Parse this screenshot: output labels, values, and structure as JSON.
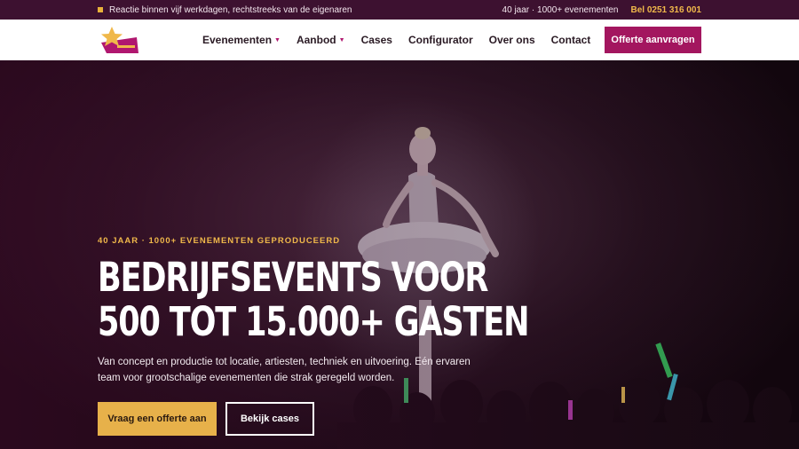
{
  "topbar": {
    "notice": "Reactie binnen vijf werkdagen, rechtstreeks van de eigenaren",
    "stats": "40 jaar · 1000+ evenementen",
    "phone": "Bel 0251 316 001"
  },
  "nav": {
    "items": [
      {
        "label": "Evenementen",
        "has_dropdown": true
      },
      {
        "label": "Aanbod",
        "has_dropdown": true
      },
      {
        "label": "Cases",
        "has_dropdown": false
      },
      {
        "label": "Configurator",
        "has_dropdown": false
      },
      {
        "label": "Over ons",
        "has_dropdown": false
      },
      {
        "label": "Contact",
        "has_dropdown": false
      }
    ],
    "cta": "Offerte aanvragen"
  },
  "hero": {
    "kicker": "40 JAAR · 1000+ EVENEMENTEN GEPRODUCEERD",
    "headline_line1": "BEDRIJFSEVENTS VOOR",
    "headline_line2": "500 TOT 15.000+ GASTEN",
    "subtitle": "Van concept en productie tot locatie, artiesten, techniek en uitvoering. Eén ervaren team voor grootschalige evenementen die strak geregeld worden.",
    "primary_button": "Vraag een offerte aan",
    "secondary_button": "Bekijk cases"
  },
  "colors": {
    "brand": "#a3165f",
    "accent": "#e7b14a",
    "topbar": "#3d1130"
  },
  "icons": [
    "star-logo-icon",
    "caret-down-icon",
    "bullet-square-icon"
  ]
}
